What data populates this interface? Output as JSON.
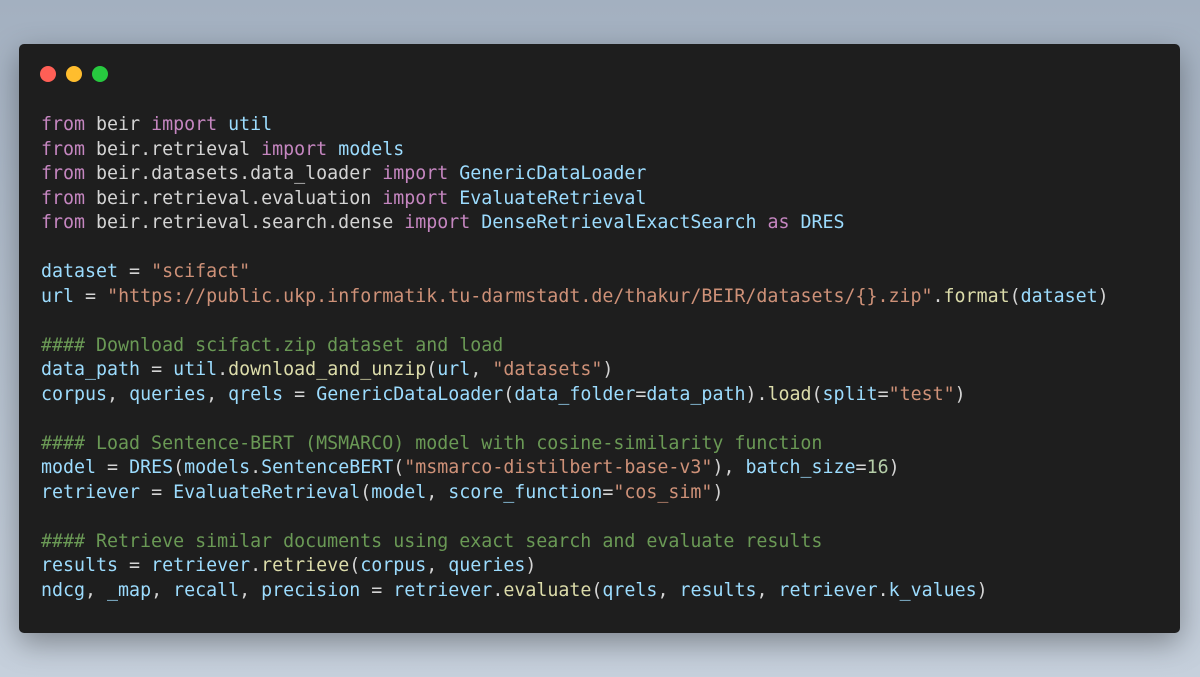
{
  "window": {
    "buttons": [
      {
        "name": "close-button",
        "color": "#ff5f56"
      },
      {
        "name": "minimize-button",
        "color": "#ffbd2e"
      },
      {
        "name": "maximize-button",
        "color": "#27c93f"
      }
    ]
  },
  "code": {
    "lines": [
      [
        [
          "keyword",
          "from"
        ],
        [
          "plain",
          " "
        ],
        [
          "module",
          "beir"
        ],
        [
          "plain",
          " "
        ],
        [
          "keyword",
          "import"
        ],
        [
          "plain",
          " "
        ],
        [
          "var",
          "util"
        ]
      ],
      [
        [
          "keyword",
          "from"
        ],
        [
          "plain",
          " "
        ],
        [
          "module",
          "beir.retrieval"
        ],
        [
          "plain",
          " "
        ],
        [
          "keyword",
          "import"
        ],
        [
          "plain",
          " "
        ],
        [
          "var",
          "models"
        ]
      ],
      [
        [
          "keyword",
          "from"
        ],
        [
          "plain",
          " "
        ],
        [
          "module",
          "beir.datasets.data_loader"
        ],
        [
          "plain",
          " "
        ],
        [
          "keyword",
          "import"
        ],
        [
          "plain",
          " "
        ],
        [
          "class",
          "GenericDataLoader"
        ]
      ],
      [
        [
          "keyword",
          "from"
        ],
        [
          "plain",
          " "
        ],
        [
          "module",
          "beir.retrieval.evaluation"
        ],
        [
          "plain",
          " "
        ],
        [
          "keyword",
          "import"
        ],
        [
          "plain",
          " "
        ],
        [
          "class",
          "EvaluateRetrieval"
        ]
      ],
      [
        [
          "keyword",
          "from"
        ],
        [
          "plain",
          " "
        ],
        [
          "module",
          "beir.retrieval.search.dense"
        ],
        [
          "plain",
          " "
        ],
        [
          "keyword",
          "import"
        ],
        [
          "plain",
          " "
        ],
        [
          "class",
          "DenseRetrievalExactSearch"
        ],
        [
          "plain",
          " "
        ],
        [
          "keyword",
          "as"
        ],
        [
          "plain",
          " "
        ],
        [
          "class",
          "DRES"
        ]
      ],
      [],
      [
        [
          "var",
          "dataset"
        ],
        [
          "plain",
          " = "
        ],
        [
          "string",
          "\"scifact\""
        ]
      ],
      [
        [
          "var",
          "url"
        ],
        [
          "plain",
          " = "
        ],
        [
          "string",
          "\"https://public.ukp.informatik.tu-darmstadt.de/thakur/BEIR/datasets/{}.zip\""
        ],
        [
          "plain",
          "."
        ],
        [
          "func",
          "format"
        ],
        [
          "plain",
          "("
        ],
        [
          "var",
          "dataset"
        ],
        [
          "plain",
          ")"
        ]
      ],
      [],
      [
        [
          "comment",
          "#### Download scifact.zip dataset and load"
        ]
      ],
      [
        [
          "var",
          "data_path"
        ],
        [
          "plain",
          " = "
        ],
        [
          "var",
          "util"
        ],
        [
          "plain",
          "."
        ],
        [
          "func",
          "download_and_unzip"
        ],
        [
          "plain",
          "("
        ],
        [
          "var",
          "url"
        ],
        [
          "plain",
          ", "
        ],
        [
          "string",
          "\"datasets\""
        ],
        [
          "plain",
          ")"
        ]
      ],
      [
        [
          "var",
          "corpus"
        ],
        [
          "plain",
          ", "
        ],
        [
          "var",
          "queries"
        ],
        [
          "plain",
          ", "
        ],
        [
          "var",
          "qrels"
        ],
        [
          "plain",
          " = "
        ],
        [
          "class",
          "GenericDataLoader"
        ],
        [
          "plain",
          "("
        ],
        [
          "var",
          "data_folder"
        ],
        [
          "plain",
          "="
        ],
        [
          "var",
          "data_path"
        ],
        [
          "plain",
          ")."
        ],
        [
          "func",
          "load"
        ],
        [
          "plain",
          "("
        ],
        [
          "var",
          "split"
        ],
        [
          "plain",
          "="
        ],
        [
          "string",
          "\"test\""
        ],
        [
          "plain",
          ")"
        ]
      ],
      [],
      [
        [
          "comment",
          "#### Load Sentence-BERT (MSMARCO) model with cosine-similarity function"
        ]
      ],
      [
        [
          "var",
          "model"
        ],
        [
          "plain",
          " = "
        ],
        [
          "class",
          "DRES"
        ],
        [
          "plain",
          "("
        ],
        [
          "var",
          "models"
        ],
        [
          "plain",
          "."
        ],
        [
          "class",
          "SentenceBERT"
        ],
        [
          "plain",
          "("
        ],
        [
          "string",
          "\"msmarco-distilbert-base-v3\""
        ],
        [
          "plain",
          "), "
        ],
        [
          "var",
          "batch_size"
        ],
        [
          "plain",
          "="
        ],
        [
          "number",
          "16"
        ],
        [
          "plain",
          ")"
        ]
      ],
      [
        [
          "var",
          "retriever"
        ],
        [
          "plain",
          " = "
        ],
        [
          "class",
          "EvaluateRetrieval"
        ],
        [
          "plain",
          "("
        ],
        [
          "var",
          "model"
        ],
        [
          "plain",
          ", "
        ],
        [
          "var",
          "score_function"
        ],
        [
          "plain",
          "="
        ],
        [
          "string",
          "\"cos_sim\""
        ],
        [
          "plain",
          ")"
        ]
      ],
      [],
      [
        [
          "comment",
          "#### Retrieve similar documents using exact search and evaluate results"
        ]
      ],
      [
        [
          "var",
          "results"
        ],
        [
          "plain",
          " = "
        ],
        [
          "var",
          "retriever"
        ],
        [
          "plain",
          "."
        ],
        [
          "func",
          "retrieve"
        ],
        [
          "plain",
          "("
        ],
        [
          "var",
          "corpus"
        ],
        [
          "plain",
          ", "
        ],
        [
          "var",
          "queries"
        ],
        [
          "plain",
          ")"
        ]
      ],
      [
        [
          "var",
          "ndcg"
        ],
        [
          "plain",
          ", "
        ],
        [
          "var",
          "_map"
        ],
        [
          "plain",
          ", "
        ],
        [
          "var",
          "recall"
        ],
        [
          "plain",
          ", "
        ],
        [
          "var",
          "precision"
        ],
        [
          "plain",
          " = "
        ],
        [
          "var",
          "retriever"
        ],
        [
          "plain",
          "."
        ],
        [
          "func",
          "evaluate"
        ],
        [
          "plain",
          "("
        ],
        [
          "var",
          "qrels"
        ],
        [
          "plain",
          ", "
        ],
        [
          "var",
          "results"
        ],
        [
          "plain",
          ", "
        ],
        [
          "var",
          "retriever"
        ],
        [
          "plain",
          "."
        ],
        [
          "var",
          "k_values"
        ],
        [
          "plain",
          ")"
        ]
      ]
    ]
  }
}
